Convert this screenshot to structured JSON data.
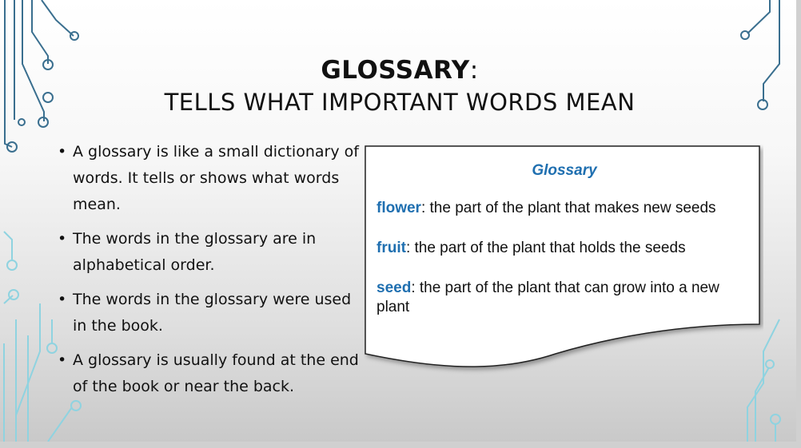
{
  "slide": {
    "title_bold": "GLOSSARY",
    "title_colon": ":",
    "subtitle": "TELLS WHAT IMPORTANT WORDS MEAN",
    "bullets": [
      "A glossary is like a small dictionary of words. It tells or shows what words mean.",
      "The words in the glossary are in alphabetical order.",
      "The words in the glossary were used in the book.",
      "A glossary is usually found at the end of the book or near the back."
    ],
    "bullet_marker": "•"
  },
  "card": {
    "title": "Glossary",
    "entries": [
      {
        "term": "flower",
        "definition": ":  the part of the plant that makes new seeds"
      },
      {
        "term": "fruit",
        "definition": ": the part of the plant that holds the seeds"
      },
      {
        "term": "seed",
        "definition": ": the part of the plant that can grow into a new plant"
      }
    ]
  },
  "colors": {
    "term_blue": "#1f6fb0",
    "circuit_dark": "#3a6f8f",
    "circuit_light": "#8fd3e0"
  }
}
